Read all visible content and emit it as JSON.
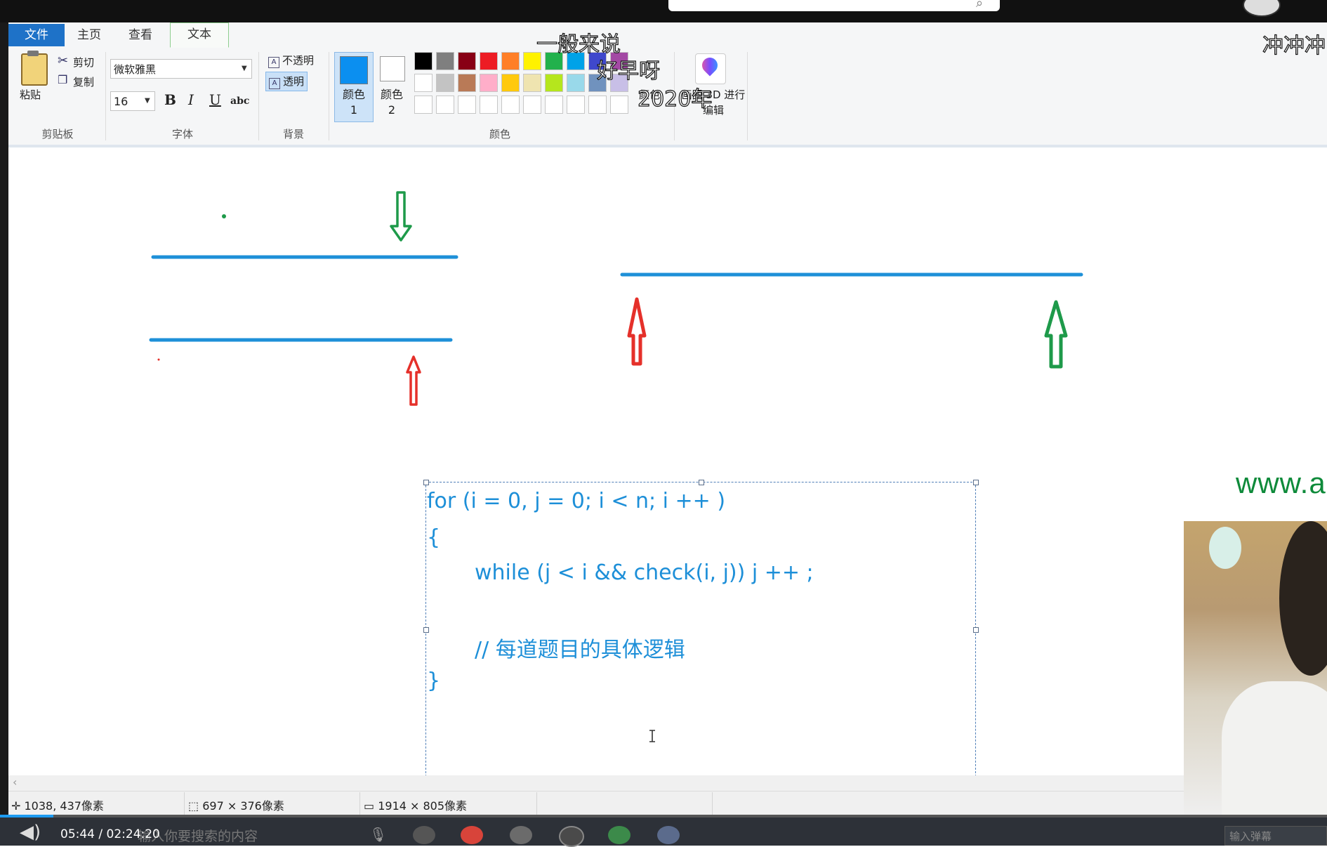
{
  "ribbon": {
    "tabs": [
      "文件",
      "主页",
      "查看",
      "文本"
    ],
    "clipboard": {
      "paste": "粘贴",
      "cut": "剪切",
      "copy": "复制",
      "group": "剪贴板"
    },
    "font": {
      "family": "微软雅黑",
      "size": "16",
      "bold": "B",
      "italic": "I",
      "underline": "U",
      "strike": "abc",
      "group": "字体"
    },
    "background": {
      "opaque": "不透明",
      "transparent": "透明",
      "group": "背景"
    },
    "colors": {
      "color1_label": "颜色 1",
      "color2_label": "颜色 2",
      "edit_label": "颜色",
      "paint3d_label": "画图 3D 进行编辑",
      "group": "颜色",
      "color1_value": "#0b8ff0",
      "color2_value": "#ffffff",
      "palette_row1": [
        "#000000",
        "#7f7f7f",
        "#880015",
        "#ed1c24",
        "#ff7f27",
        "#fff200",
        "#22b14c",
        "#00a2e8",
        "#3f48cc",
        "#a349a4"
      ],
      "palette_row2": [
        "#ffffff",
        "#c3c3c3",
        "#b97a57",
        "#ffaec9",
        "#ffc90e",
        "#efe4b0",
        "#b5e61d",
        "#99d9ea",
        "#7092be",
        "#c8bfe7"
      ]
    }
  },
  "canvas": {
    "code_lines": [
      "for (i = 0, j = 0; i < n; i ++ )",
      "{",
      "while (j < i && check(i, j)) j ++ ;",
      "// 每道题目的具体逻辑",
      "}"
    ],
    "watermark": "www.a",
    "colors": {
      "blue_line": "#1e90d8",
      "green_arrow": "#1e9a4a",
      "red_arrow": "#e5302a"
    }
  },
  "status": {
    "cursor_pos": "1038, 437像素",
    "selection_size": "697 × 376像素",
    "image_size": "1914 × 805像素"
  },
  "overlay": {
    "danmaku": [
      "一般来说",
      "好早呀",
      "2020年",
      "冲冲冲"
    ]
  },
  "player": {
    "timecode": "05:44 / 02:24:20",
    "search_placeholder": "输入你要搜索的内容",
    "danmaku_placeholder": "输入弹幕",
    "progress": 0.04
  }
}
